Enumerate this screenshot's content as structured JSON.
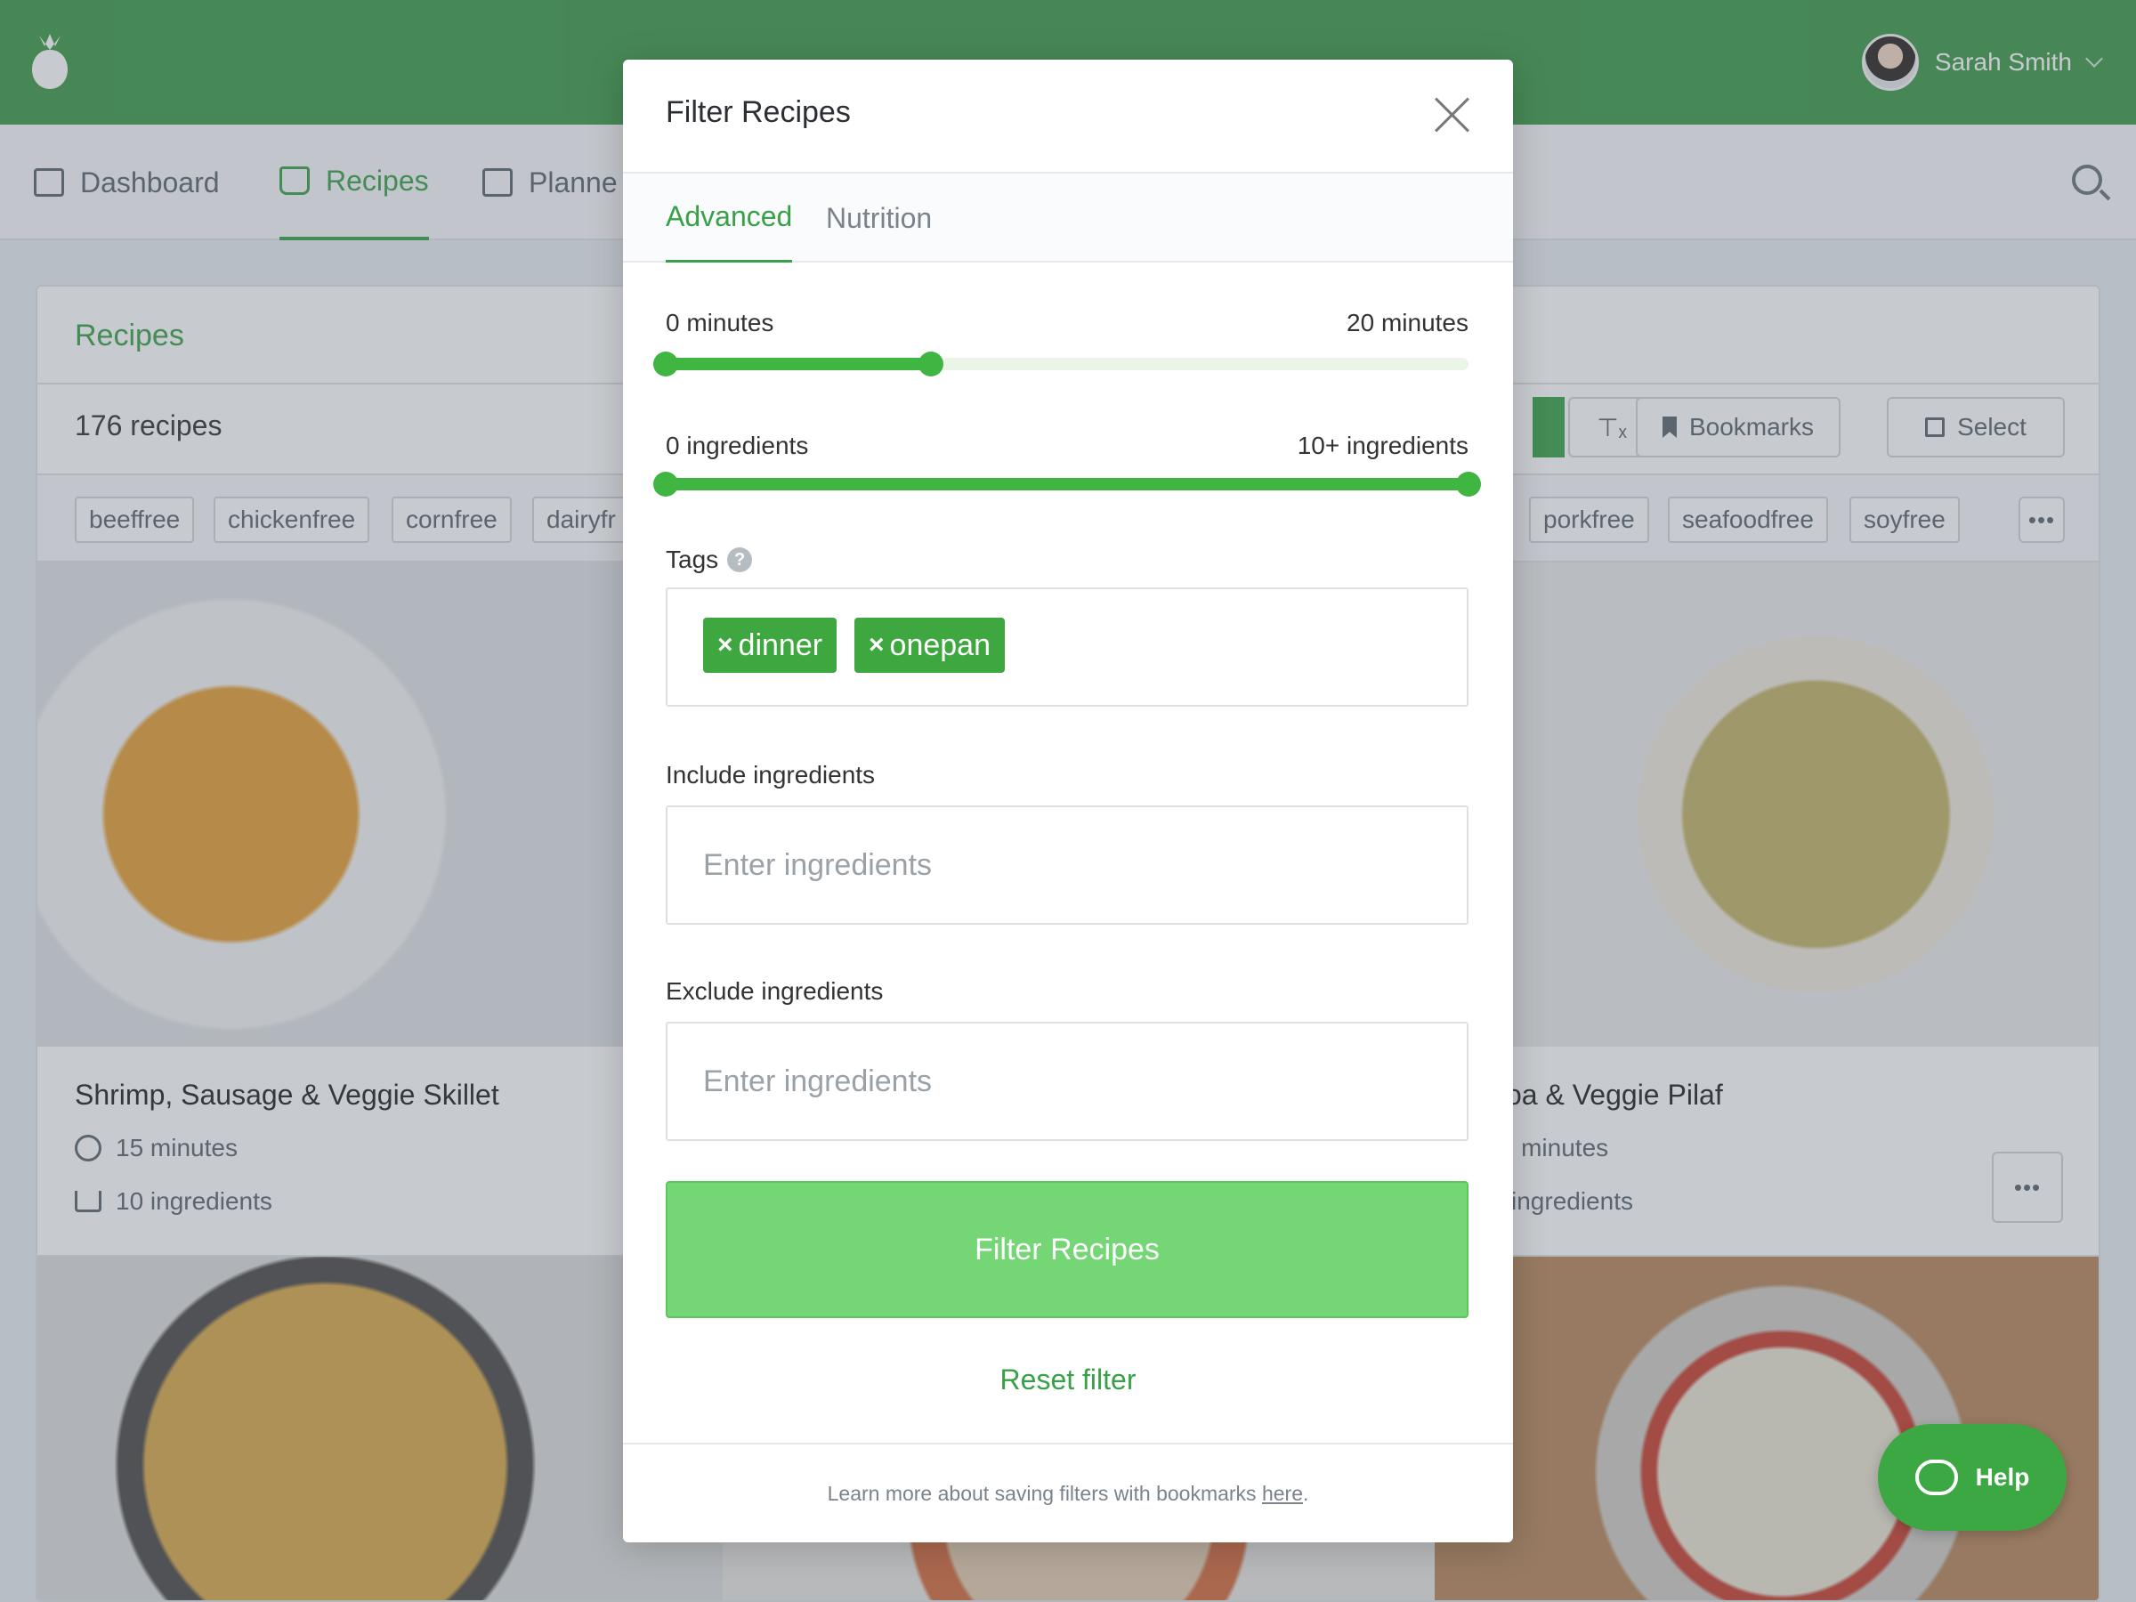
{
  "header": {
    "user_name": "Sarah Smith"
  },
  "nav": {
    "items": [
      {
        "label": "Dashboard",
        "icon": "dashboard-icon",
        "active": false
      },
      {
        "label": "Recipes",
        "icon": "recipes-tray-icon",
        "active": true
      },
      {
        "label": "Planne",
        "icon": "calendar-icon",
        "active": false
      }
    ]
  },
  "recipes": {
    "title": "Recipes",
    "count": "176 recipes",
    "toolbar": {
      "bookmarks": "Bookmarks",
      "select": "Select"
    },
    "tags": [
      "beeffree",
      "chickenfree",
      "cornfree",
      "dairyfr",
      "porkfree",
      "seafoodfree",
      "soyfree"
    ],
    "cards": [
      {
        "title": "Shrimp, Sausage & Veggie Skillet",
        "time": "15 minutes",
        "ingredients": "10 ingredients"
      },
      {
        "title": "oa & Veggie Pilaf",
        "time": ") minutes",
        "ingredients": "ingredients"
      }
    ]
  },
  "modal": {
    "title": "Filter Recipes",
    "tabs": [
      "Advanced",
      "Nutrition"
    ],
    "time_range": {
      "min_label": "0 minutes",
      "max_label": "20 minutes",
      "fill_fraction_start": 0.0,
      "fill_fraction_end": 0.33
    },
    "ingredient_range": {
      "min_label": "0 ingredients",
      "max_label": "10+ ingredients",
      "fill_fraction_start": 0.0,
      "fill_fraction_end": 1.0
    },
    "tags_label": "Tags",
    "tags_help": "?",
    "selected_tags": [
      "dinner",
      "onepan"
    ],
    "include_label": "Include ingredients",
    "exclude_label": "Exclude ingredients",
    "ingredient_placeholder": "Enter ingredients",
    "submit_label": "Filter Recipes",
    "reset_label": "Reset filter",
    "footer_text": "Learn more about saving filters with bookmarks ",
    "footer_link": "here",
    "footer_period": "."
  },
  "help_widget": {
    "label": "Help"
  },
  "colors": {
    "brand_green": "#3d9a4a",
    "accent_green": "#38a148",
    "button_green": "#74d674"
  }
}
